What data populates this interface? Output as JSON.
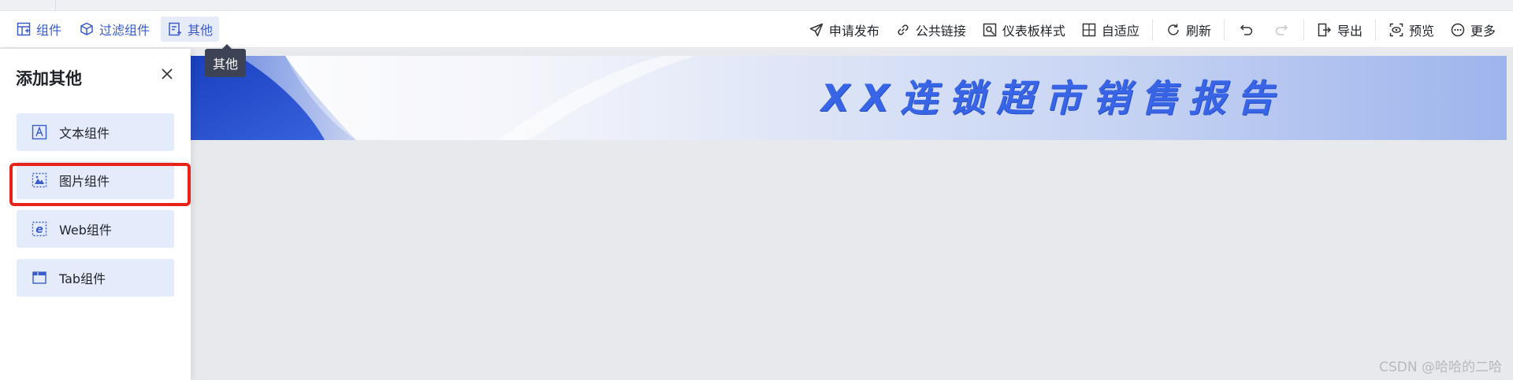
{
  "toolbar": {
    "tabs": [
      {
        "label": "组件",
        "icon": "component-icon",
        "active": false
      },
      {
        "label": "过滤组件",
        "icon": "filter-cube-icon",
        "active": false
      },
      {
        "label": "其他",
        "icon": "other-doc-icon",
        "active": true
      }
    ],
    "actions": [
      {
        "label": "申请发布",
        "icon": "send-icon"
      },
      {
        "label": "公共链接",
        "icon": "link-icon"
      },
      {
        "label": "仪表板样式",
        "icon": "dashboard-style-icon"
      },
      {
        "label": "自适应",
        "icon": "adaptive-icon"
      },
      {
        "label": "刷新",
        "icon": "refresh-icon"
      },
      {
        "label": "",
        "icon": "undo-icon"
      },
      {
        "label": "",
        "icon": "redo-icon"
      },
      {
        "label": "导出",
        "icon": "export-icon"
      },
      {
        "label": "预览",
        "icon": "preview-icon"
      },
      {
        "label": "更多",
        "icon": "more-icon"
      }
    ]
  },
  "tooltip": {
    "text": "其他"
  },
  "panel": {
    "title": "添加其他",
    "items": [
      {
        "label": "文本组件",
        "icon": "text-component-icon"
      },
      {
        "label": "图片组件",
        "icon": "image-component-icon",
        "highlighted": true
      },
      {
        "label": "Web组件",
        "icon": "web-component-icon"
      },
      {
        "label": "Tab组件",
        "icon": "tab-component-icon"
      }
    ]
  },
  "banner": {
    "title": "XX连锁超市销售报告"
  },
  "watermark": {
    "text": "CSDN @哈哈的二哈"
  },
  "colors": {
    "accent": "#3a5ccc",
    "highlight": "#e8231a",
    "banner_text": "#3864e6"
  }
}
